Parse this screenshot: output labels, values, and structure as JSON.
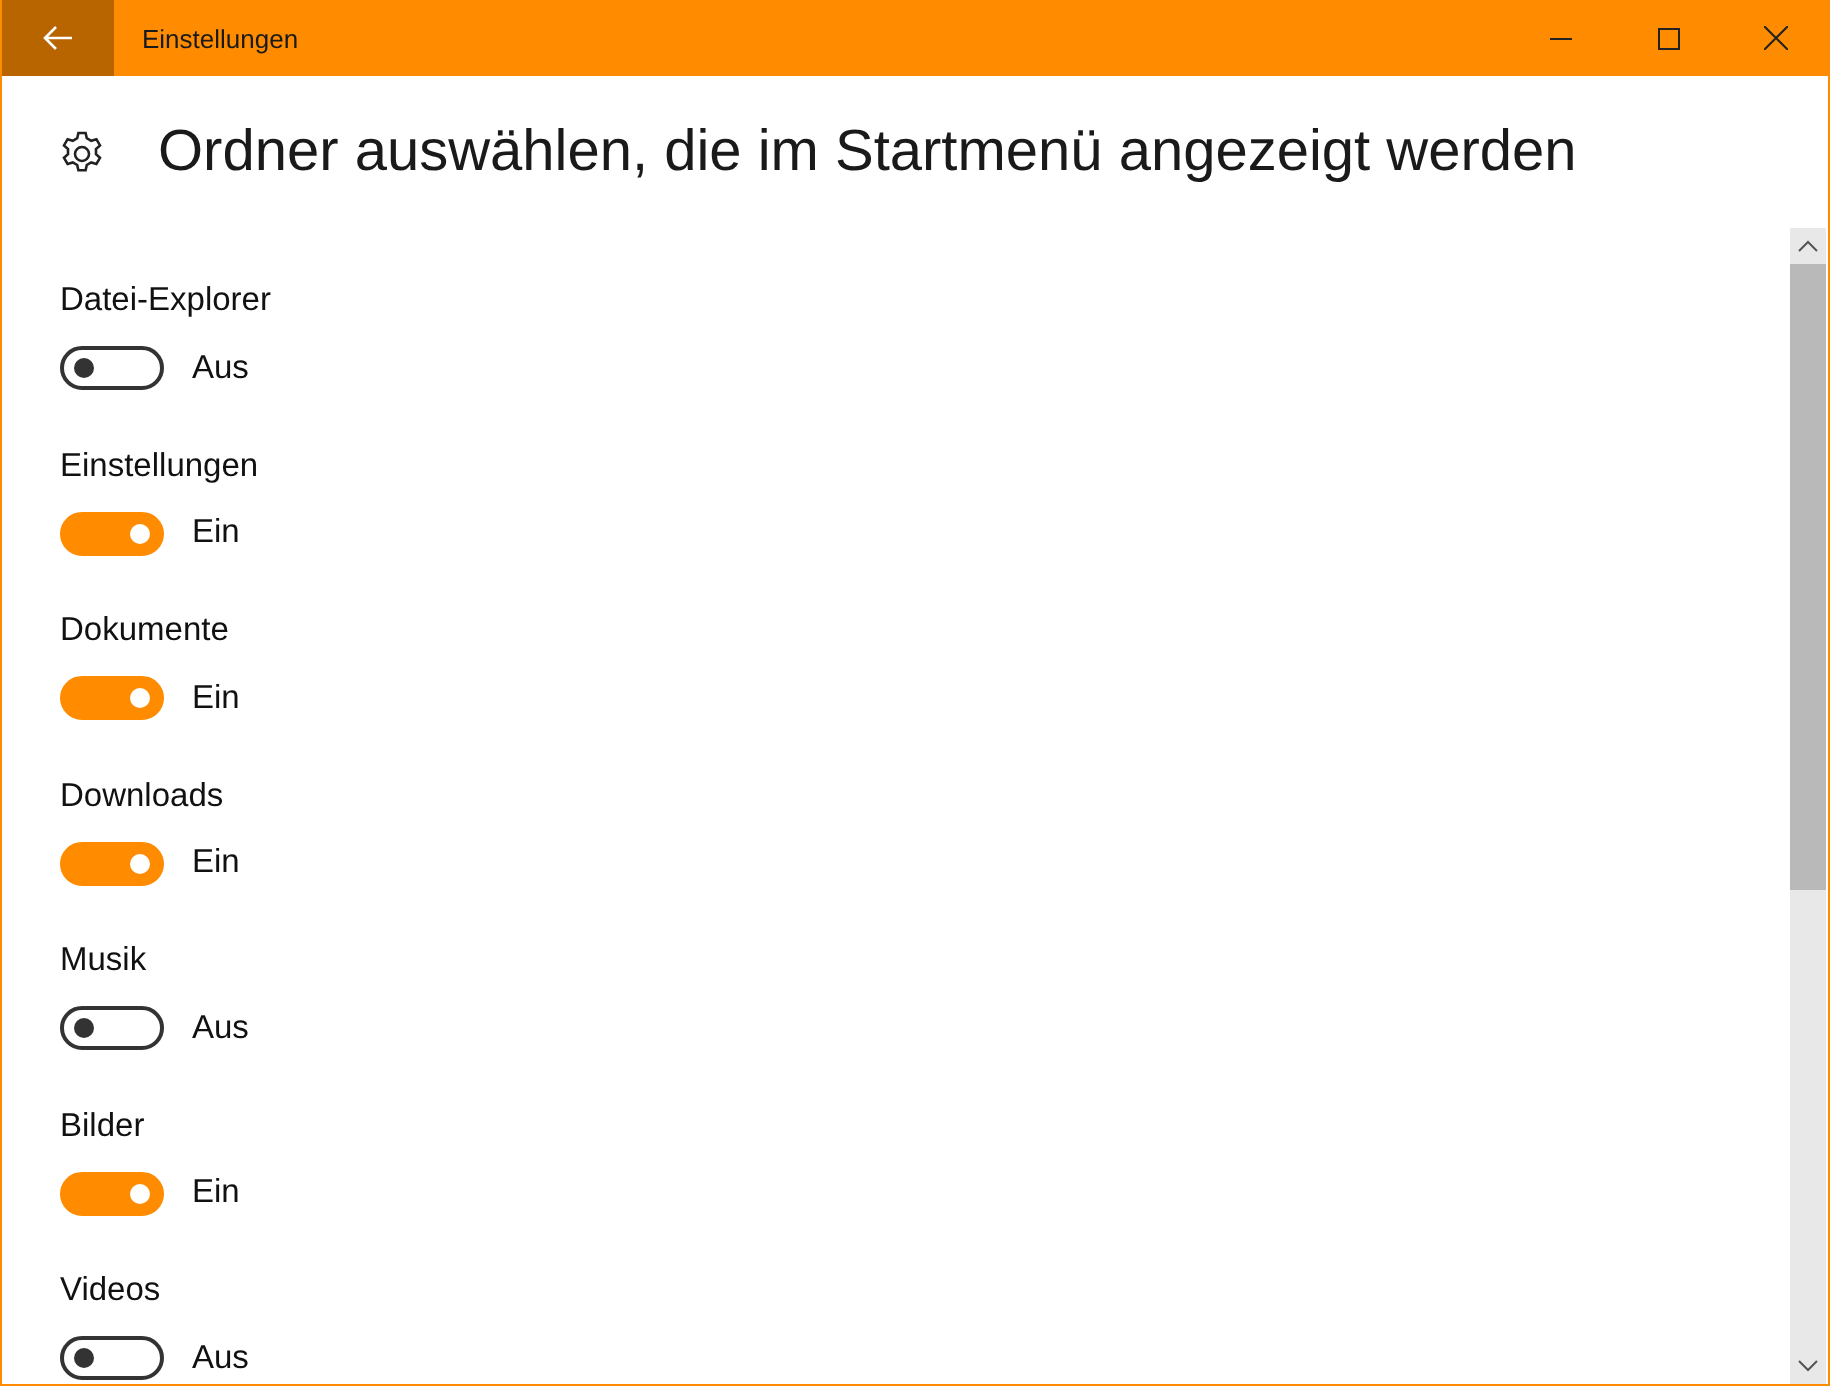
{
  "window": {
    "title": "Einstellungen"
  },
  "heading": "Ordner auswählen, die im Startmenü angezeigt werden",
  "folders": [
    {
      "name": "Datei-Explorer",
      "on": false,
      "state_label": "Aus"
    },
    {
      "name": "Einstellungen",
      "on": true,
      "state_label": "Ein"
    },
    {
      "name": "Dokumente",
      "on": true,
      "state_label": "Ein"
    },
    {
      "name": "Downloads",
      "on": true,
      "state_label": "Ein"
    },
    {
      "name": "Musik",
      "on": false,
      "state_label": "Aus"
    },
    {
      "name": "Bilder",
      "on": true,
      "state_label": "Ein"
    },
    {
      "name": "Videos",
      "on": false,
      "state_label": "Aus"
    }
  ]
}
